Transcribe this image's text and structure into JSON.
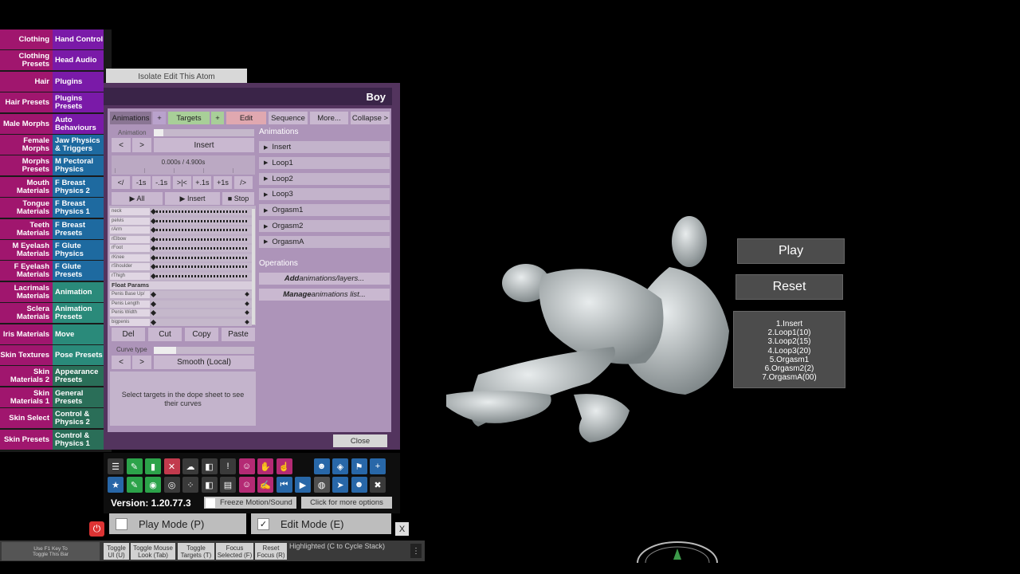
{
  "left_menu": {
    "col1": [
      "Clothing",
      "Clothing Presets",
      "Hair",
      "Hair Presets",
      "Male Morphs",
      "Female Morphs",
      "Morphs Presets",
      "Mouth Materials",
      "Tongue Materials",
      "Teeth Materials",
      "M Eyelash Materials",
      "F Eyelash Materials",
      "Lacrimals Materials",
      "Sclera Materials",
      "Iris Materials",
      "Skin Textures",
      "Skin Materials 2",
      "Skin Materials 1",
      "Skin Select",
      "Skin Presets"
    ],
    "col2": [
      "Hand Control",
      "Head Audio",
      "Plugins",
      "Plugins Presets",
      "Auto Behaviours",
      "Jaw Physics & Triggers",
      "M Pectoral Physics",
      "F Breast Physics 2",
      "F Breast Physics 1",
      "F Breast Presets",
      "F Glute Physics",
      "F Glute Presets",
      "Animation",
      "Animation Presets",
      "Move",
      "Pose Presets",
      "Appearance Presets",
      "General Presets",
      "Control & Physics 2",
      "Control & Physics 1"
    ]
  },
  "isolate_label": "Isolate Edit This Atom",
  "panel_title": "Boy",
  "tabs": [
    "Animations",
    "+",
    "Targets",
    "+",
    "Edit",
    "Sequence",
    "More...",
    "Collapse >"
  ],
  "controls": {
    "animation_label": "Animation",
    "prev": "<",
    "next": ">",
    "insert": "Insert",
    "time": "0.000s / 4.900s",
    "step_buttons": [
      "</",
      "-1s",
      "-.1s",
      ">|<",
      "+.1s",
      "+1s",
      "/>"
    ],
    "play_all": "▶ All",
    "play_insert": "▶ Insert",
    "stop": "■ Stop"
  },
  "tracks": [
    "neck",
    "pelvis",
    "rArm",
    "rElbow",
    "rFoot",
    "rKnee",
    "rShoulder",
    "rThigh"
  ],
  "float_params_label": "Float Params",
  "float_params": [
    "Penis Base Up/",
    "Penis Length",
    "Penis Width",
    "bigpenis"
  ],
  "edit_buttons": [
    "Del",
    "Cut",
    "Copy",
    "Paste"
  ],
  "curve": {
    "label": "Curve type",
    "value": "Smooth (Local)"
  },
  "hint": "Select targets in the dope sheet to see their curves",
  "animations_header": "Animations",
  "animations": [
    "Insert",
    "Loop1",
    "Loop2",
    "Loop3",
    "Orgasm1",
    "Orgasm2",
    "OrgasmA"
  ],
  "operations_header": "Operations",
  "operations": [
    {
      "bold": "Add",
      "rest": " animations/layers..."
    },
    {
      "bold": "Manage",
      "rest": " animations list..."
    }
  ],
  "close": "Close",
  "version": "Version: 1.20.77.3",
  "freeze": "Freeze Motion/Sound",
  "more_options": "Click for more options",
  "play_mode": "Play Mode (P)",
  "edit_mode": "Edit Mode (E)",
  "close_x": "X",
  "bottom": {
    "f1": "Use F1 Key To Toggle This Bar",
    "buttons": [
      "Toggle UI (U)",
      "Toggle Mouse Look (Tab)",
      "Toggle Targets (T)",
      "Focus Selected (F)",
      "Reset Focus (R)"
    ],
    "highlighted": "Highlighted (C to Cycle Stack)"
  },
  "scene": {
    "play": "Play",
    "reset": "Reset",
    "list": [
      "1.Insert",
      "2.Loop1(10)",
      "3.Loop2(15)",
      "4.Loop3(20)",
      "5.Orgasm1",
      "6.Orgasm2(2)",
      "7.OrgasmA(00)"
    ]
  },
  "colors": {
    "magenta": "#a0166e",
    "purple": "#7a1aa8",
    "blue": "#1e6aa0",
    "teal": "#2a8a7a",
    "green": "#2a6e58",
    "panel": "#53345e",
    "inner": "#ad94b9"
  }
}
